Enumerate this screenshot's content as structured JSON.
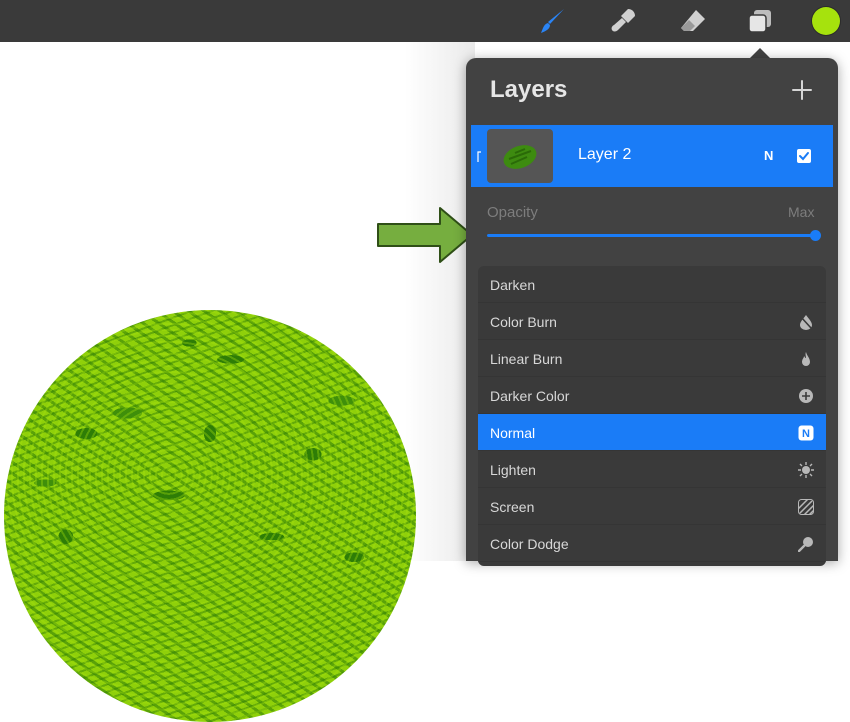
{
  "toolbar": {
    "tools": [
      {
        "icon": "paintbrush-icon",
        "active": true
      },
      {
        "icon": "smudge-icon",
        "active": false
      },
      {
        "icon": "eraser-icon",
        "active": false
      },
      {
        "icon": "layers-icon",
        "active": false
      }
    ],
    "current_color": "#a6e20d"
  },
  "layers_panel": {
    "title": "Layers",
    "add_icon": "plus-icon",
    "layer": {
      "name": "Layer 2",
      "blend_mode_letter": "N",
      "visible": true
    },
    "opacity": {
      "label": "Opacity",
      "value_label": "Max",
      "value": 1.0
    },
    "blend_modes": [
      {
        "label": "Darken",
        "icon": "moon-icon",
        "selected": false
      },
      {
        "label": "Color Burn",
        "icon": "burn-icon",
        "selected": false
      },
      {
        "label": "Linear Burn",
        "icon": "flame-icon",
        "selected": false
      },
      {
        "label": "Darker Color",
        "icon": "plus-circle-icon",
        "selected": false
      },
      {
        "label": "Normal",
        "icon": "n-badge-icon",
        "badge": "N",
        "selected": true
      },
      {
        "label": "Lighten",
        "icon": "sun-icon",
        "selected": false
      },
      {
        "label": "Screen",
        "icon": "hatch-icon",
        "selected": false
      },
      {
        "label": "Color Dodge",
        "icon": "magnifier-icon",
        "selected": false
      }
    ]
  },
  "colors": {
    "accent": "#1a7cf7",
    "panel_bg": "#424242",
    "topbar_bg": "#3a3a3a",
    "arrow_green": "#76ae3f"
  }
}
